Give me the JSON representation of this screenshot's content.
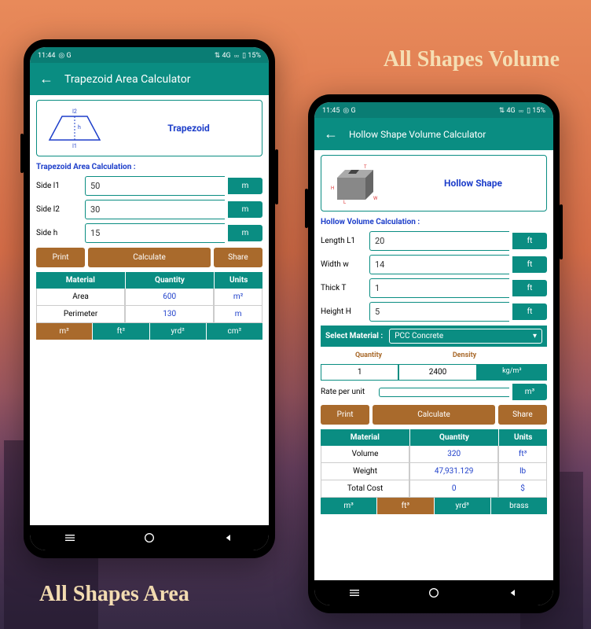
{
  "headings": {
    "top": "All Shapes Volume",
    "bottom": "All Shapes Area"
  },
  "phone1": {
    "status": {
      "time": "11:44",
      "battery": "15%",
      "network": "4G"
    },
    "title": "Trapezoid Area Calculator",
    "shape_title": "Trapezoid",
    "diagram_labels": {
      "top": "l2",
      "bottom": "l1",
      "height": "h"
    },
    "section": "Trapezoid Area Calculation :",
    "inputs": [
      {
        "label": "Side l1",
        "value": "50",
        "unit": "m"
      },
      {
        "label": "Side l2",
        "value": "30",
        "unit": "m"
      },
      {
        "label": "Side h",
        "value": "15",
        "unit": "m"
      }
    ],
    "buttons": {
      "print": "Print",
      "calc": "Calculate",
      "share": "Share"
    },
    "table": {
      "headers": [
        "Material",
        "Quantity",
        "Units"
      ],
      "rows": [
        {
          "material": "Area",
          "qty": "600",
          "unit": "m²"
        },
        {
          "material": "Perimeter",
          "qty": "130",
          "unit": "m"
        }
      ]
    },
    "unit_tabs": [
      "m²",
      "ft²",
      "yrd²",
      "cm²"
    ]
  },
  "phone2": {
    "status": {
      "time": "11:45",
      "battery": "15%",
      "network": "4G"
    },
    "title": "Hollow Shape Volume Calculator",
    "shape_title": "Hollow Shape",
    "diagram_labels": {
      "h": "H",
      "l": "L",
      "w": "W",
      "t": "T"
    },
    "section": "Hollow Volume Calculation :",
    "inputs": [
      {
        "label": "Length L1",
        "value": "20",
        "unit": "ft"
      },
      {
        "label": "Width w",
        "value": "14",
        "unit": "ft"
      },
      {
        "label": "Thick T",
        "value": "1",
        "unit": "ft"
      },
      {
        "label": "Height H",
        "value": "5",
        "unit": "ft"
      }
    ],
    "material_select": {
      "label": "Select Material :",
      "value": "PCC Concrete"
    },
    "qd": {
      "qty_label": "Quantity",
      "den_label": "Density",
      "qty": "1",
      "den": "2400",
      "den_unit": "kg/m³"
    },
    "rate": {
      "label": "Rate per unit",
      "value": "",
      "unit": "m³"
    },
    "buttons": {
      "print": "Print",
      "calc": "Calculate",
      "share": "Share"
    },
    "table": {
      "headers": [
        "Material",
        "Quantity",
        "Units"
      ],
      "rows": [
        {
          "material": "Volume",
          "qty": "320",
          "unit": "ft³"
        },
        {
          "material": "Weight",
          "qty": "47,931.129",
          "unit": "lb"
        },
        {
          "material": "Total Cost",
          "qty": "0",
          "unit": "$"
        }
      ]
    },
    "unit_tabs": [
      "m³",
      "ft³",
      "yrd³",
      "brass"
    ]
  }
}
